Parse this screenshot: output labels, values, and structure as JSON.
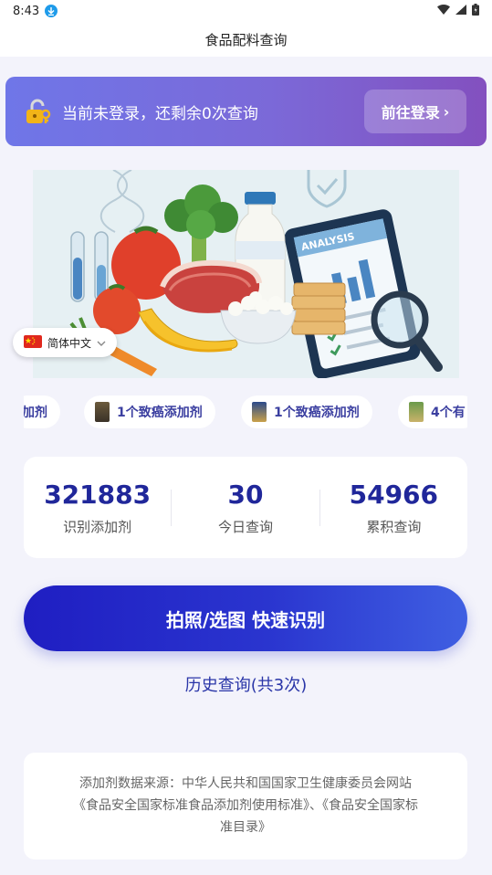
{
  "status_bar": {
    "time": "8:43"
  },
  "header": {
    "title": "食品配料查询"
  },
  "login_banner": {
    "message": "当前未登录，还剩余0次查询",
    "button_label": "前往登录",
    "button_arrow": "›",
    "colors": {
      "start": "#6f76e8",
      "end": "#8350bf"
    }
  },
  "hero": {
    "analysis_label": "ANALYSIS"
  },
  "language": {
    "flag": "🇨🇳",
    "label": "简体中文"
  },
  "ticker": {
    "items": [
      {
        "label": "加剂"
      },
      {
        "label": "1个致癌添加剂"
      },
      {
        "label": "1个致癌添加剂"
      },
      {
        "label": "4个有"
      }
    ]
  },
  "stats": [
    {
      "value": "321883",
      "label": "识别添加剂"
    },
    {
      "value": "30",
      "label": "今日查询"
    },
    {
      "value": "54966",
      "label": "累积查询"
    }
  ],
  "scan_button": {
    "label": "拍照/选图 快速识别",
    "color": "#2a35cf"
  },
  "history": {
    "label": "历史查询(共3次)"
  },
  "source": {
    "line1": "添加剂数据来源：中华人民共和国国家卫生健康委员会网站",
    "line2": "《食品安全国家标准食品添加剂使用标准》、《食品安全国家标",
    "line3": "准目录》"
  }
}
